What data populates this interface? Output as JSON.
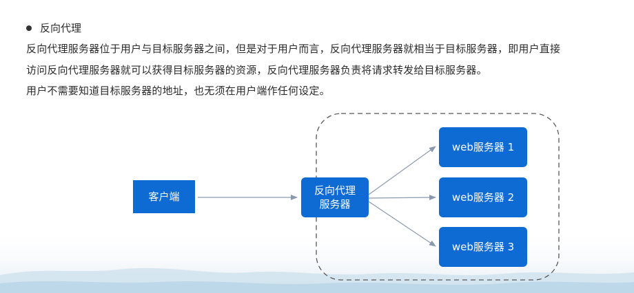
{
  "section": {
    "heading": "反向代理",
    "paragraph_line1": "反向代理服务器位于用户与目标服务器之间，但是对于用户而言，反向代理服务器就相当于目标服务器，即用户直接",
    "paragraph_line2": "访问反向代理服务器就可以获得目标服务器的资源，反向代理服务器负责将请求转发给目标服务器。",
    "paragraph_line3": "用户不需要知道目标服务器的地址，也无须在用户端作任何设定。"
  },
  "diagram": {
    "client_label": "客户端",
    "proxy_label_line1": "反向代理",
    "proxy_label_line2": "服务器",
    "servers": [
      {
        "label": "web服务器 1"
      },
      {
        "label": "web服务器 2"
      },
      {
        "label": "web服务器 3"
      }
    ],
    "colors": {
      "node_fill": "#0e6bd3",
      "arrow": "#8a99ad",
      "group_border": "#555555"
    }
  }
}
